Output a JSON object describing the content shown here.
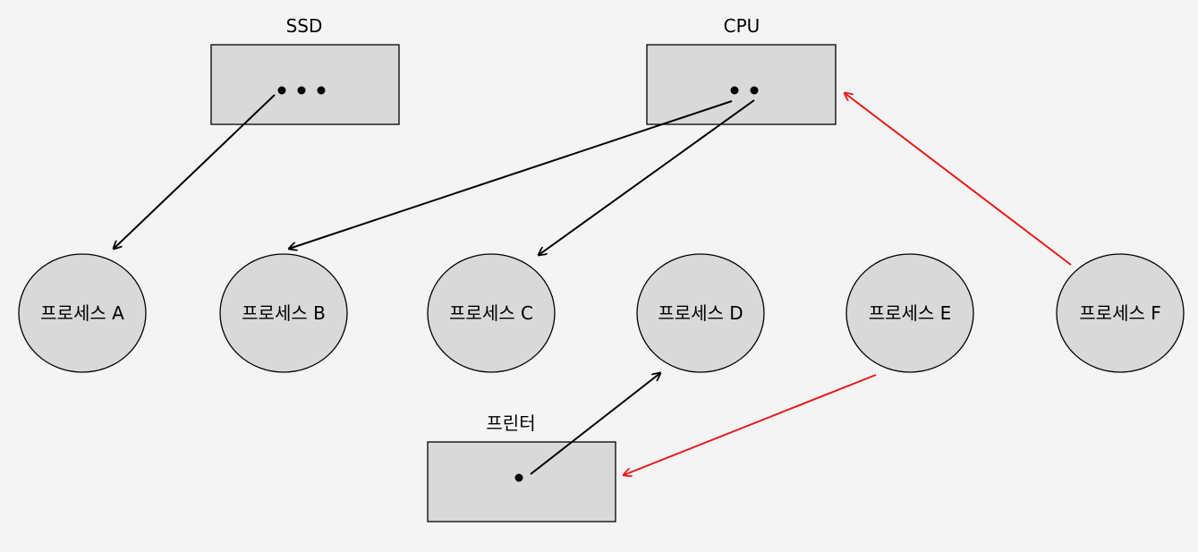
{
  "colors": {
    "background": "#f4f4f4",
    "node_fill": "#d9d9d9",
    "stroke": "#000000",
    "highlight_edge": "#e8191b"
  },
  "resources": {
    "ssd": {
      "label": "SSD",
      "dot_count": 3
    },
    "cpu": {
      "label": "CPU",
      "dot_count": 2
    },
    "printer": {
      "label": "프린터",
      "dot_count": 1
    }
  },
  "processes": {
    "a": "프로세스 A",
    "b": "프로세스 B",
    "c": "프로세스 C",
    "d": "프로세스 D",
    "e": "프로세스 E",
    "f": "프로세스 F"
  },
  "edges": [
    {
      "from": "ssd",
      "to": "process-a",
      "kind": "assignment"
    },
    {
      "from": "cpu",
      "to": "process-b",
      "kind": "assignment"
    },
    {
      "from": "cpu",
      "to": "process-c",
      "kind": "assignment"
    },
    {
      "from": "printer",
      "to": "process-d",
      "kind": "assignment"
    },
    {
      "from": "process-e",
      "to": "printer",
      "kind": "request"
    },
    {
      "from": "process-f",
      "to": "cpu",
      "kind": "request"
    }
  ]
}
